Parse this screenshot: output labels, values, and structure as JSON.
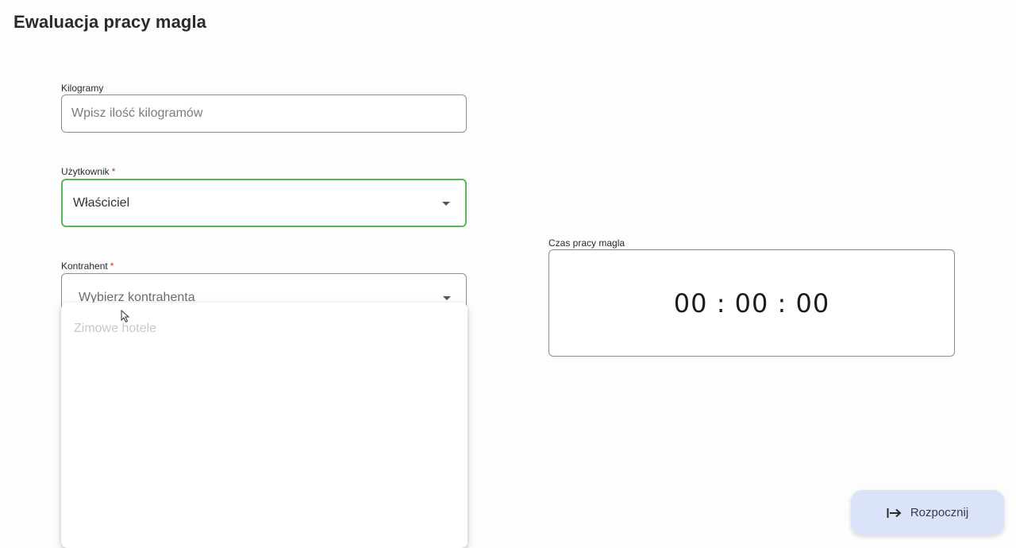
{
  "page": {
    "title": "Ewaluacja pracy magla"
  },
  "kilograms": {
    "label": "Kilogramy",
    "placeholder": "Wpisz ilość kilogramów",
    "value": ""
  },
  "user": {
    "label": "Użytkownik",
    "required_mark": "*",
    "selected": "Właściciel",
    "border_color": "#58b65c"
  },
  "contractor": {
    "label": "Kontrahent",
    "required_mark": "*",
    "placeholder": "Wybierz kontrahenta",
    "options": [
      "Zimowe hotele"
    ]
  },
  "timer": {
    "label": "Czas pracy magla",
    "value": "00 : 00 : 00"
  },
  "actions": {
    "start_label": "Rozpocznij",
    "start_icon": "arrow-right-to-bar-icon",
    "start_bg": "#dbe3f8"
  },
  "colors": {
    "required": "#c0392b",
    "focused_border": "#58b65c"
  }
}
